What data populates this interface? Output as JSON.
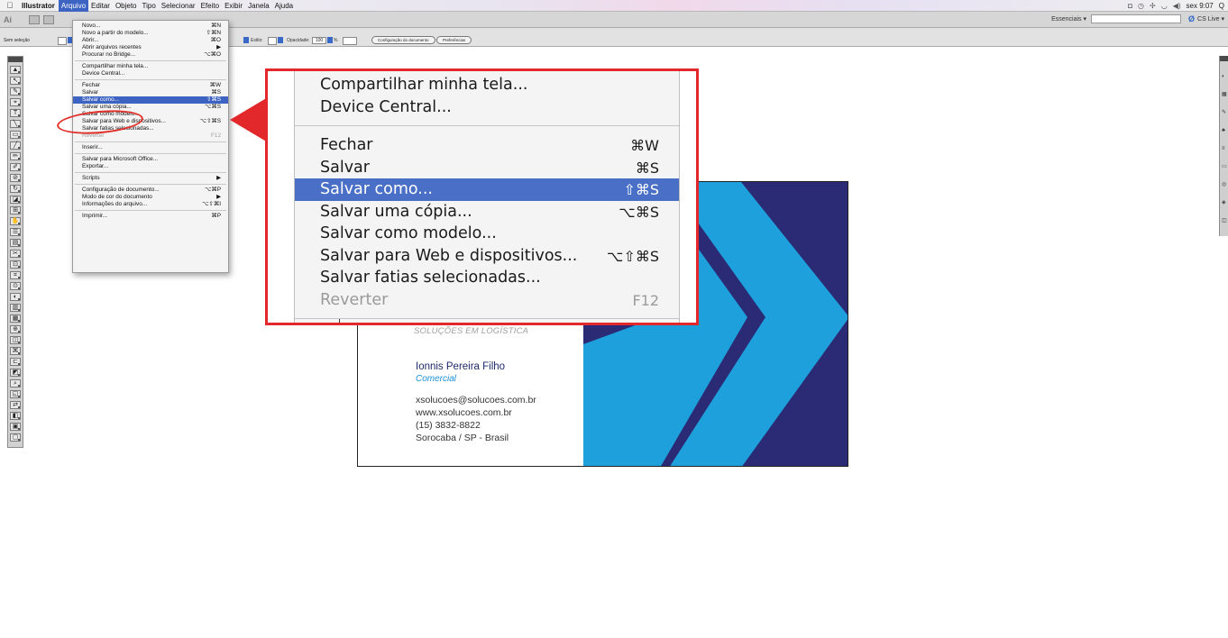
{
  "menubar": {
    "app_name": "Illustrator",
    "items": [
      "Arquivo",
      "Editar",
      "Objeto",
      "Tipo",
      "Selecionar",
      "Efeito",
      "Exibir",
      "Janela",
      "Ajuda"
    ],
    "active_item": "Arquivo",
    "clock": "sex 9:07",
    "search_glyph": "Q"
  },
  "appbar": {
    "logo": "Ai",
    "workspace": "Essenciais ▾",
    "cs_live": "CS Live ▾"
  },
  "control_bar": {
    "selection_label": "Sem seleção",
    "style_label": "Estilo:",
    "opacity_label": "Opacidade:",
    "opacity_value": "100",
    "opacity_unit": "%",
    "doc_setup_button": "Configuração do documento",
    "prefs_button": "Preferências"
  },
  "file_menu": [
    {
      "label": "Novo...",
      "shortcut": "⌘N"
    },
    {
      "label": "Novo a partir do modelo...",
      "shortcut": "⇧⌘N"
    },
    {
      "label": "Abrir...",
      "shortcut": "⌘O"
    },
    {
      "label": "Abrir arquivos recentes",
      "shortcut": "▶"
    },
    {
      "label": "Procurar no Bridge...",
      "shortcut": "⌥⌘O"
    },
    {
      "sep": true
    },
    {
      "label": "Compartilhar minha tela...",
      "shortcut": ""
    },
    {
      "label": "Device Central...",
      "shortcut": ""
    },
    {
      "sep": true
    },
    {
      "label": "Fechar",
      "shortcut": "⌘W"
    },
    {
      "label": "Salvar",
      "shortcut": "⌘S"
    },
    {
      "label": "Salvar como...",
      "shortcut": "⇧⌘S",
      "selected": true
    },
    {
      "label": "Salvar uma cópia...",
      "shortcut": "⌥⌘S"
    },
    {
      "label": "Salvar como modelo...",
      "shortcut": ""
    },
    {
      "label": "Salvar para Web e dispositivos...",
      "shortcut": "⌥⇧⌘S"
    },
    {
      "label": "Salvar fatias selecionadas...",
      "shortcut": ""
    },
    {
      "label": "Reverter",
      "shortcut": "F12",
      "disabled": true
    },
    {
      "sep": true
    },
    {
      "label": "Inserir...",
      "shortcut": ""
    },
    {
      "sep": true
    },
    {
      "label": "Salvar para Microsoft Office...",
      "shortcut": ""
    },
    {
      "label": "Exportar...",
      "shortcut": ""
    },
    {
      "sep": true
    },
    {
      "label": "Scripts",
      "shortcut": "▶"
    },
    {
      "sep": true
    },
    {
      "label": "Configuração de documento...",
      "shortcut": "⌥⌘P"
    },
    {
      "label": "Modo de cor do documento",
      "shortcut": "▶"
    },
    {
      "label": "Informações do arquivo...",
      "shortcut": "⌥⇧⌘I"
    },
    {
      "sep": true
    },
    {
      "label": "Imprimir...",
      "shortcut": "⌘P"
    }
  ],
  "zoom_callout": [
    {
      "label": "Compartilhar minha tela...",
      "shortcut": ""
    },
    {
      "label": "Device Central...",
      "shortcut": ""
    },
    {
      "sep": true
    },
    {
      "label": "Fechar",
      "shortcut": "⌘W"
    },
    {
      "label": "Salvar",
      "shortcut": "⌘S"
    },
    {
      "label": "Salvar como...",
      "shortcut": "⇧⌘S",
      "selected": true
    },
    {
      "label": "Salvar uma cópia...",
      "shortcut": "⌥⌘S"
    },
    {
      "label": "Salvar como modelo...",
      "shortcut": ""
    },
    {
      "label": "Salvar para Web e dispositivos...",
      "shortcut": "⌥⇧⌘S"
    },
    {
      "label": "Salvar fatias selecionadas...",
      "shortcut": ""
    },
    {
      "label": "Reverter",
      "shortcut": "F12",
      "disabled": true
    },
    {
      "sep": true
    }
  ],
  "business_card": {
    "tagline": "SOLUÇÕES EM LOGÍSTICA",
    "name": "Ionnis Pereira Filho",
    "role": "Comercial",
    "email": "xsolucoes@solucoes.com.br",
    "website": "www.xsolucoes.com.br",
    "phone": "(15) 3832-8822",
    "location": "Sorocaba / SP - Brasil",
    "colors": {
      "navy": "#2b2a74",
      "cyan": "#1ea0dc",
      "text_name": "#1f2a6b",
      "text_role": "#1c8fd6"
    }
  },
  "colors": {
    "highlight": "#3c62c2",
    "callout_border": "#e2282a"
  },
  "tools": [
    "▲",
    "↖",
    "✎",
    "⌖",
    "T",
    "╲",
    "▭",
    "╱",
    "✏",
    "✐",
    "⊘",
    "↻",
    "◪",
    "⊞",
    "✋",
    "☰",
    "▤",
    "✂",
    "⊡",
    "⌗",
    "⊙",
    "◐",
    "▥",
    "▦",
    "⊕",
    "◫",
    "⌘",
    "⊏",
    "◩",
    "⌕",
    "◱",
    "⇄",
    "◧",
    "▣",
    "▢"
  ]
}
